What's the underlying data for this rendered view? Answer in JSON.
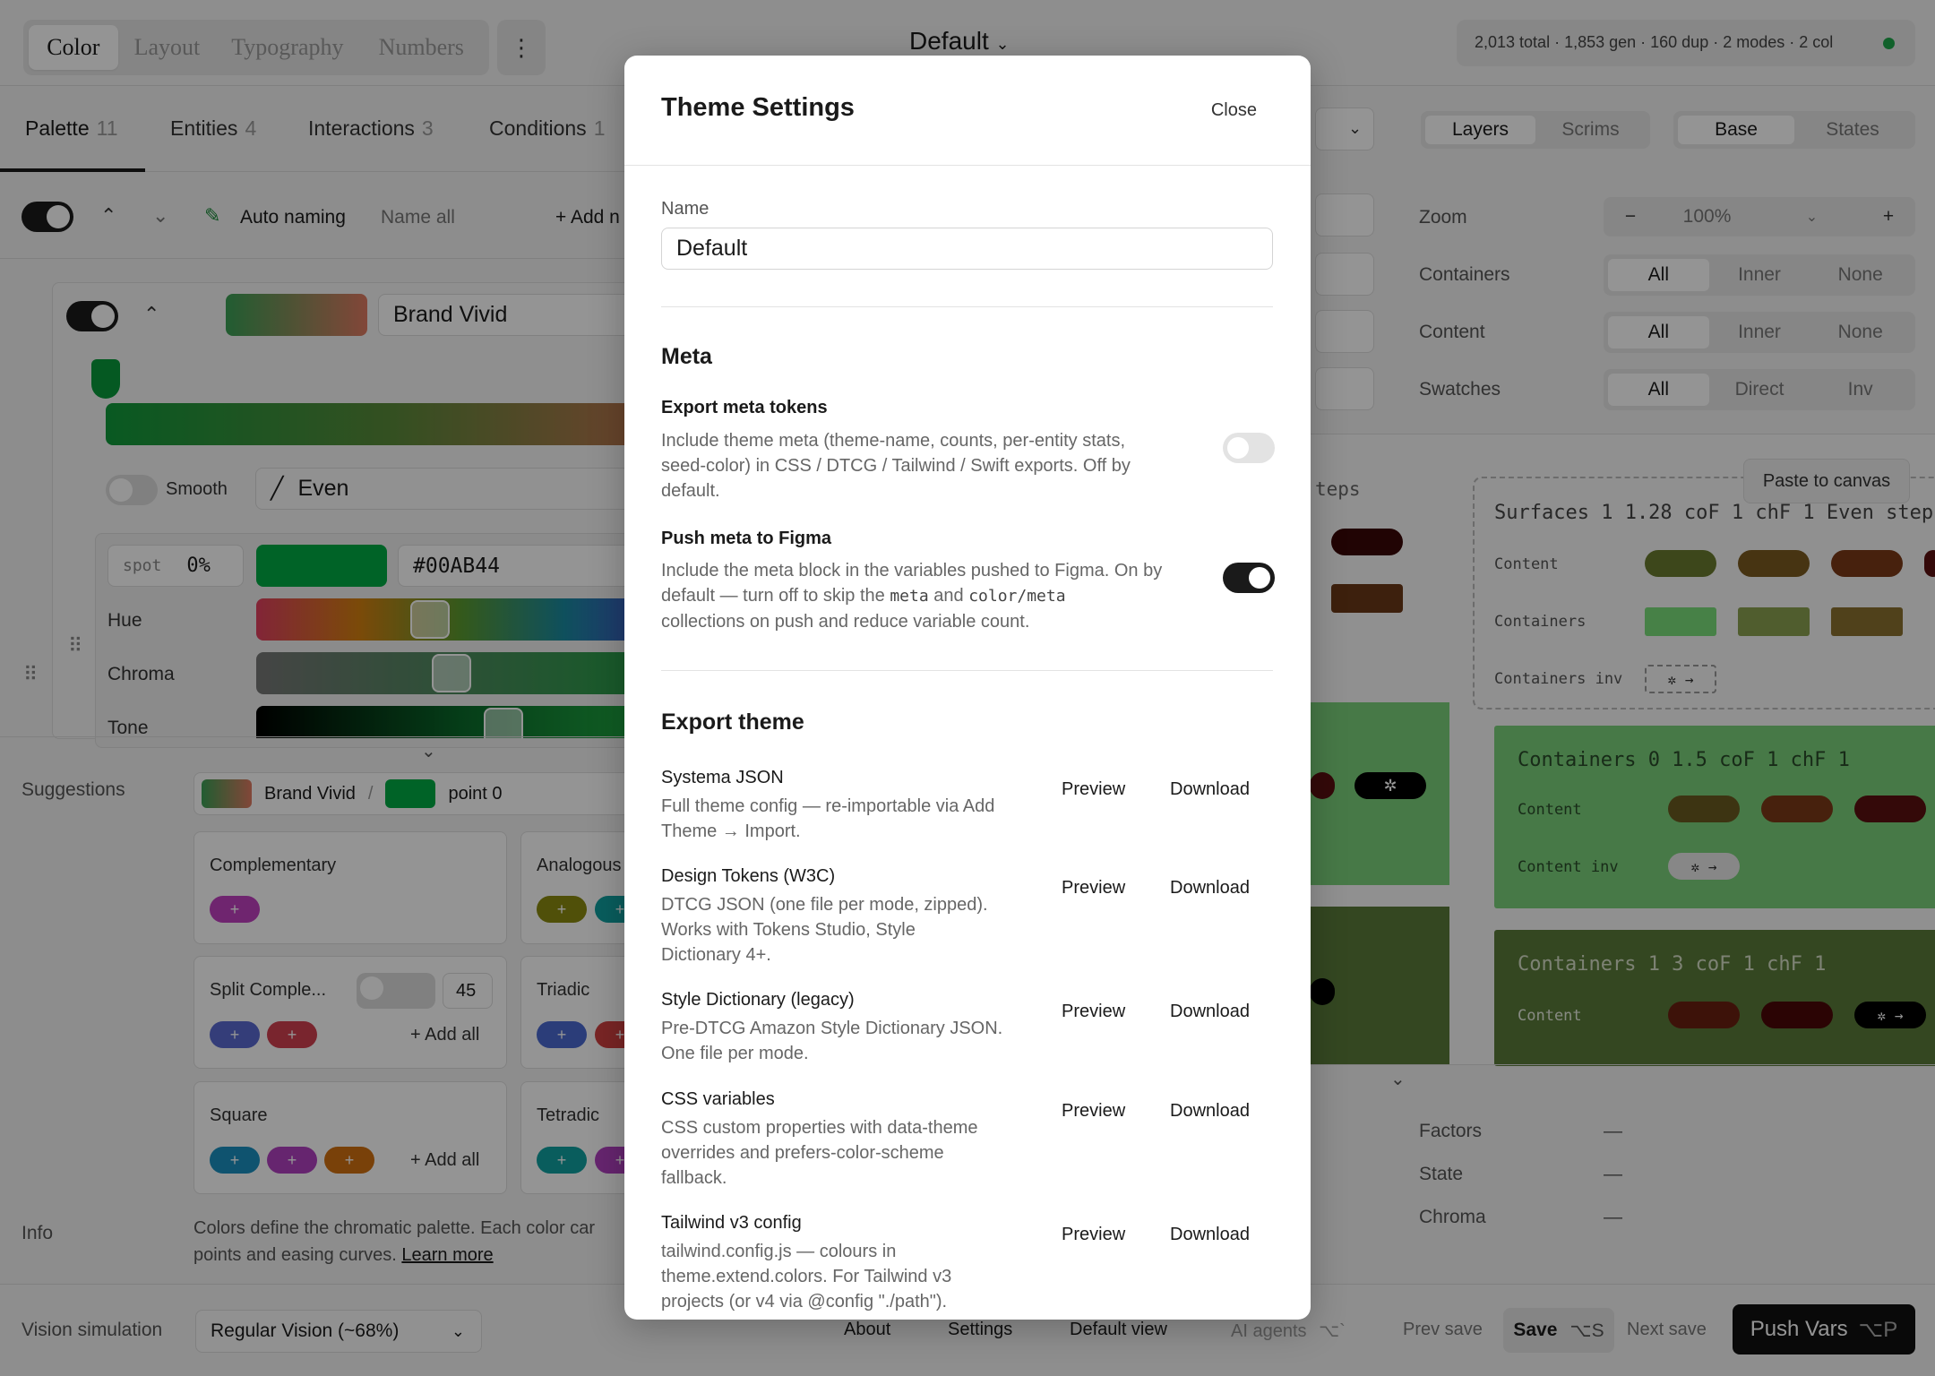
{
  "topbar": {
    "tabs": [
      "Color",
      "Layout",
      "Typography",
      "Numbers"
    ],
    "theme_name": "Default",
    "stats": "2,013 total · 1,853 gen · 160 dup · 2 modes · 2 col",
    "status_color": "#1ea84a"
  },
  "left_tabs": [
    {
      "label": "Palette",
      "count": "11"
    },
    {
      "label": "Entities",
      "count": "4"
    },
    {
      "label": "Interactions",
      "count": "3"
    },
    {
      "label": "Conditions",
      "count": "1"
    }
  ],
  "toolbar": {
    "auto_naming": "Auto naming",
    "name_all": "Name all",
    "add": "+ Add n"
  },
  "color_entry": {
    "name": "Brand Vivid",
    "smooth_label": "Smooth",
    "easing": "Even",
    "spot_label": "spot",
    "spot_value": "0%",
    "hex": "#00AB44",
    "sliders": [
      "Hue",
      "Chroma",
      "Tone"
    ]
  },
  "suggestions": {
    "label": "Suggestions",
    "source_name": "Brand Vivid",
    "source_point": "point 0",
    "groups": [
      {
        "title": "Complementary"
      },
      {
        "title": "Analogous"
      },
      {
        "title": "Split Comple...",
        "value": "45",
        "add_all": "+ Add all"
      },
      {
        "title": "Triadic"
      },
      {
        "title": "Square",
        "add_all": "+ Add all"
      },
      {
        "title": "Tetradic"
      }
    ]
  },
  "info": {
    "label": "Info",
    "text": "Colors define the chromatic palette. Each color car",
    "text2": "points and easing curves.",
    "link": "Learn more"
  },
  "right_panel": {
    "view_tabs_a": [
      "Layers",
      "Scrims"
    ],
    "view_tabs_b": [
      "Base",
      "States"
    ],
    "zoom_label": "Zoom",
    "zoom_minus": "−",
    "zoom_value": "100%",
    "zoom_plus": "+",
    "rows": [
      {
        "label": "Containers",
        "options": [
          "All",
          "Inner",
          "None"
        ]
      },
      {
        "label": "Content",
        "options": [
          "All",
          "Inner",
          "None"
        ]
      },
      {
        "label": "Swatches",
        "options": [
          "All",
          "Direct",
          "Inv"
        ]
      }
    ],
    "paste_to_canvas": "Paste to canvas",
    "steps_partial": "teps",
    "surfaces": "Surfaces 1  1.28 coF 1 chF 1 Even step",
    "canvas_rows": [
      "Content",
      "Containers",
      "Containers inv"
    ],
    "containers0": "Containers 0  1.5 coF 1 chF 1",
    "containers0_rows": [
      "Content",
      "Content inv"
    ],
    "containers1": "Containers 1  3 coF 1 chF 1",
    "containers1_rows": [
      "Content"
    ],
    "meta_rows": [
      {
        "label": "Factors",
        "value": "—"
      },
      {
        "label": "State",
        "value": "—"
      },
      {
        "label": "Chroma",
        "value": "—"
      }
    ],
    "inv_glyph": "✲ →"
  },
  "bottombar": {
    "vision_label": "Vision simulation",
    "vision_value": "Regular Vision (~68%)",
    "links": [
      "About",
      "Settings",
      "Default view",
      "AI agents"
    ],
    "ai_shortcut": "⌥`",
    "prev_save": "Prev save",
    "save": "Save",
    "save_shortcut": "⌥S",
    "next_save": "Next save",
    "push": "Push Vars",
    "push_shortcut": "⌥P"
  },
  "modal": {
    "title": "Theme Settings",
    "close": "Close",
    "name_label": "Name",
    "name_value": "Default",
    "meta_heading": "Meta",
    "export_meta_title": "Export meta tokens",
    "export_meta_desc1": "Include theme meta (theme-name, counts, per-entity stats,",
    "export_meta_desc2": "seed-color) in CSS / DTCG / Tailwind / Swift exports. Off by",
    "export_meta_desc3": "default.",
    "export_meta_on": false,
    "push_meta_title": "Push meta to Figma",
    "push_meta_desc1": "Include the meta block in the variables pushed to Figma. On by",
    "push_meta_desc2a": "default — turn off to skip the",
    "push_meta_code1": "meta",
    "push_meta_and": "and",
    "push_meta_code2": "color/meta",
    "push_meta_desc3": "collections on push and reduce variable count.",
    "push_meta_on": true,
    "export_heading": "Export theme",
    "preview_label": "Preview",
    "download_label": "Download",
    "exports": [
      {
        "title": "Systema JSON",
        "desc": [
          "Full theme config — re-importable via Add",
          "Theme → Import."
        ]
      },
      {
        "title": "Design Tokens (W3C)",
        "desc": [
          "DTCG JSON (one file per mode, zipped).",
          "Works with Tokens Studio, Style",
          "Dictionary 4+."
        ]
      },
      {
        "title": "Style Dictionary (legacy)",
        "desc": [
          "Pre-DTCG Amazon Style Dictionary JSON.",
          "One file per mode."
        ]
      },
      {
        "title": "CSS variables",
        "desc": [
          "CSS custom properties with data-theme",
          "overrides and prefers-color-scheme",
          "fallback."
        ]
      },
      {
        "title": "Tailwind v3 config",
        "desc": [
          "tailwind.config.js — colours in",
          "theme.extend.colors. For Tailwind v3",
          "projects (or v4 via @config \"./path\")."
        ]
      }
    ]
  }
}
